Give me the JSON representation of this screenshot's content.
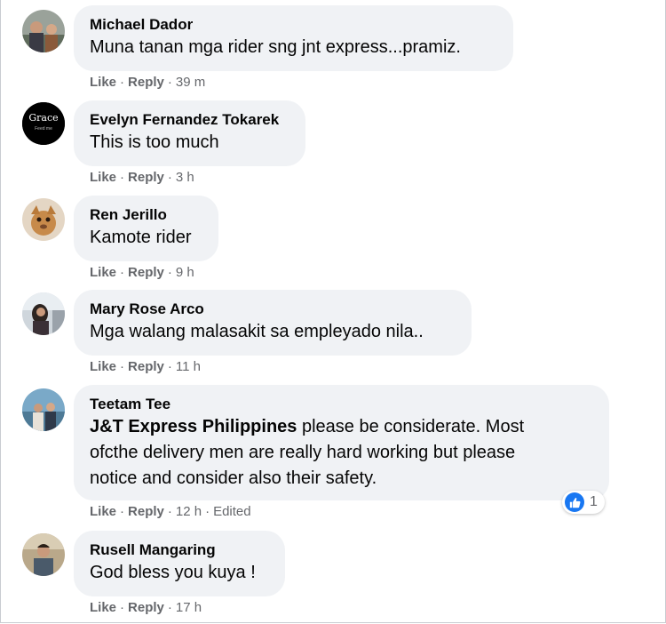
{
  "comments": [
    {
      "author": "Michael Dador",
      "text": "Muna tanan mga rider sng jnt express...pramiz.",
      "like": "Like",
      "reply": "Reply",
      "time": "39 m"
    },
    {
      "author": "Evelyn Fernandez Tokarek",
      "text": "This is too much",
      "like": "Like",
      "reply": "Reply",
      "time": "3 h",
      "avatar_text": "Grace",
      "avatar_subtext": "Feed me"
    },
    {
      "author": "Ren Jerillo",
      "text": "Kamote rider",
      "like": "Like",
      "reply": "Reply",
      "time": "9 h"
    },
    {
      "author": "Mary Rose Arco",
      "text": "Mga walang malasakit sa empleyado nila..",
      "like": "Like",
      "reply": "Reply",
      "time": "11 h"
    },
    {
      "author": "Teetam Tee",
      "mention": "J&T Express Philippines",
      "text_line1": " please be considerate. Most",
      "text_line2": "ofcthe delivery men are really hard working but please",
      "text_line3": "notice and consider also their safety.",
      "like": "Like",
      "reply": "Reply",
      "time": "12 h",
      "edited": "Edited",
      "reaction_icon": "thumbs-up-icon",
      "reaction_count": "1"
    },
    {
      "author": "Rusell Mangaring",
      "text": "God bless you kuya !",
      "like": "Like",
      "reply": "Reply",
      "time": "17 h"
    }
  ],
  "separator": "·",
  "colors": {
    "bubble": "#f0f2f5",
    "meta": "#65676b",
    "like_blue": "#1877f2"
  }
}
